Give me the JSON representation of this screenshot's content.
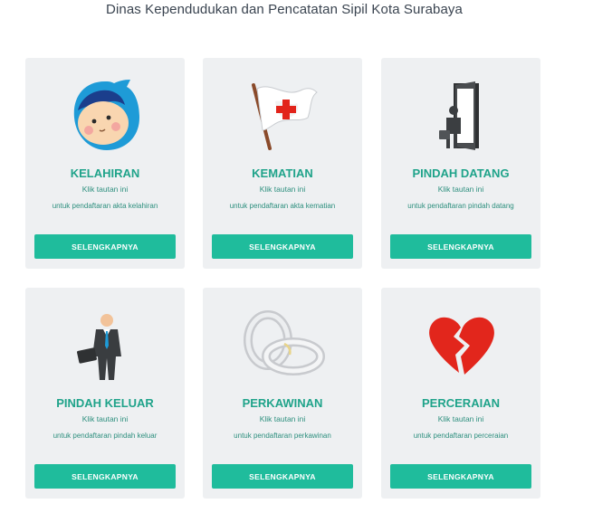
{
  "header": {
    "title": "Dinas Kependudukan dan Pencatatan Sipil Kota Surabaya"
  },
  "cards": [
    {
      "title": "KELAHIRAN",
      "subtitle": "Klik tautan ini",
      "description": "untuk pendaftaran akta kelahiran",
      "button": "SELENGKAPNYA",
      "icon": "baby-icon"
    },
    {
      "title": "KEMATIAN",
      "subtitle": "Klik tautan ini",
      "description": "untuk pendaftaran akta kematian",
      "button": "SELENGKAPNYA",
      "icon": "red-cross-flag-icon"
    },
    {
      "title": "PINDAH DATANG",
      "subtitle": "Klik tautan ini",
      "description": "untuk pendaftaran pindah datang",
      "button": "SELENGKAPNYA",
      "icon": "person-entering-door-icon"
    },
    {
      "title": "PINDAH KELUAR",
      "subtitle": "Klik tautan ini",
      "description": "untuk pendaftaran pindah keluar",
      "button": "SELENGKAPNYA",
      "icon": "businessman-briefcase-icon"
    },
    {
      "title": "PERKAWINAN",
      "subtitle": "Klik tautan ini",
      "description": "untuk pendaftaran perkawinan",
      "button": "SELENGKAPNYA",
      "icon": "wedding-rings-icon"
    },
    {
      "title": "PERCERAIAN",
      "subtitle": "Klik tautan ini",
      "description": "untuk pendaftaran perceraian",
      "button": "SELENGKAPNYA",
      "icon": "broken-heart-icon"
    }
  ],
  "colors": {
    "accent": "#1fbc9c",
    "title_text": "#1fa38a",
    "card_bg": "#eef0f2"
  }
}
